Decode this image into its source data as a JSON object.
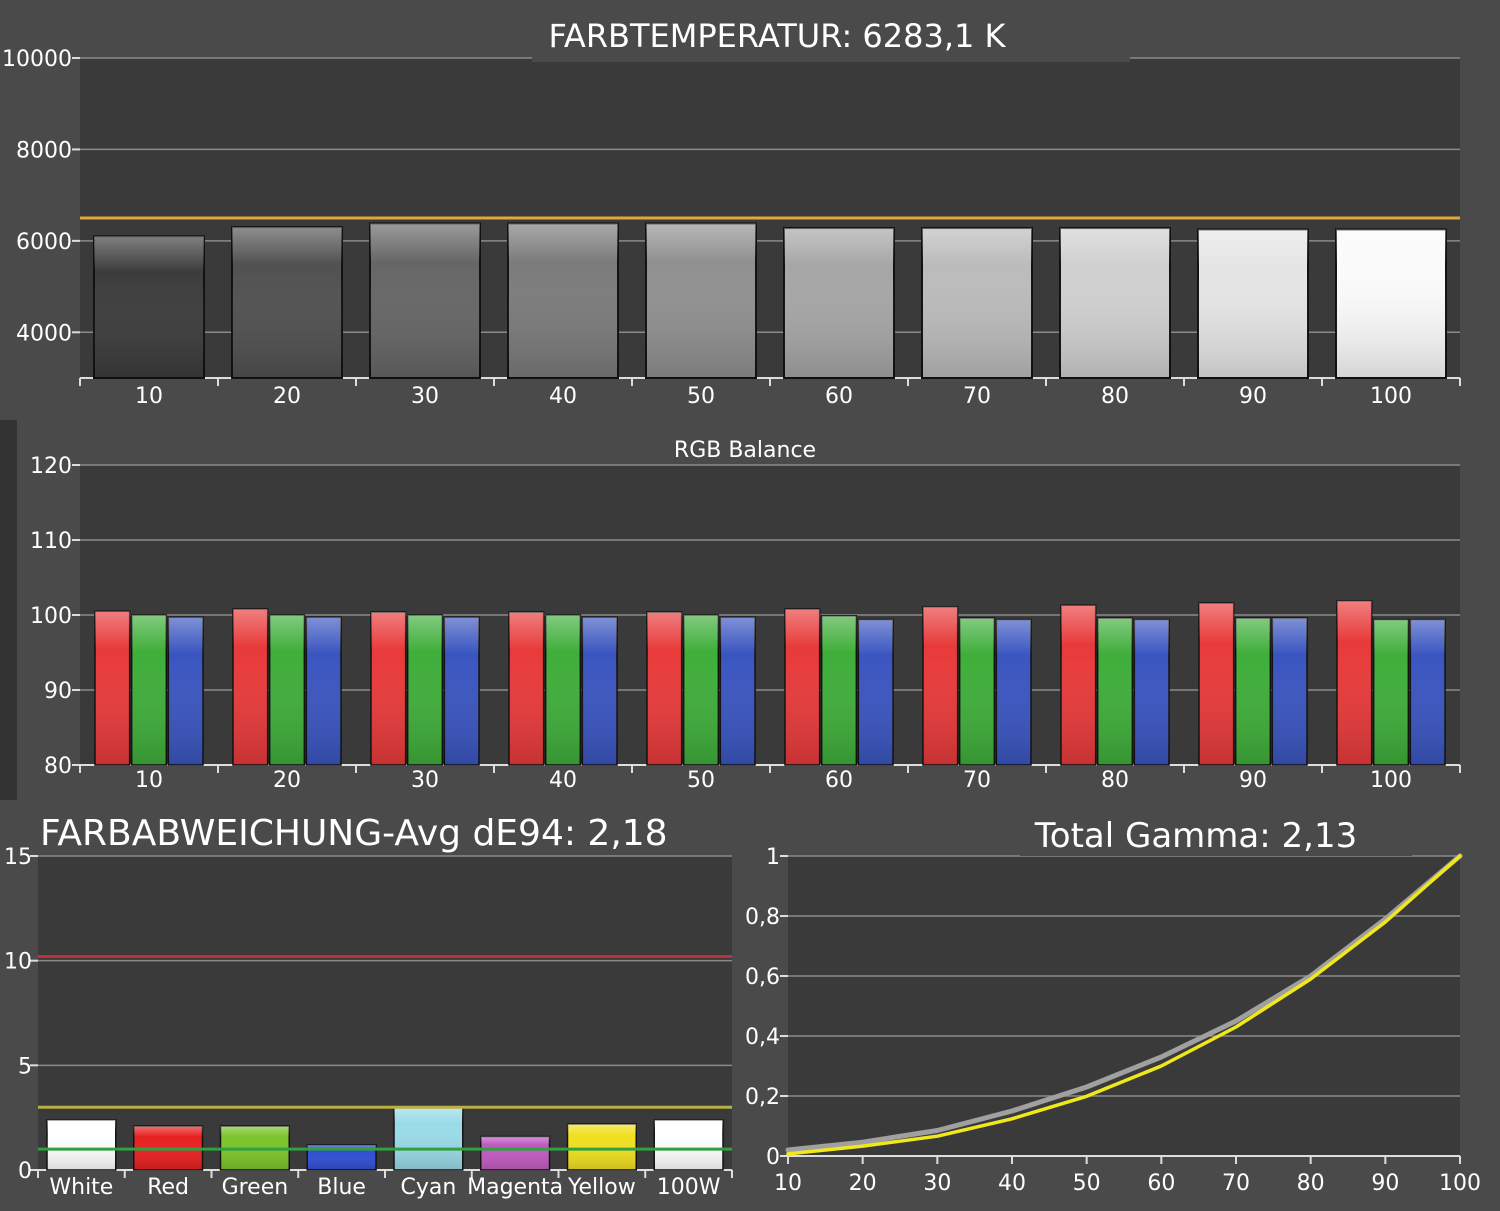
{
  "chart_data": [
    {
      "type": "bar",
      "title": "FARBTEMPERATUR: 6283,1 K",
      "categories": [
        "10",
        "20",
        "30",
        "40",
        "50",
        "60",
        "70",
        "80",
        "90",
        "100"
      ],
      "values": [
        6100,
        6300,
        6380,
        6380,
        6380,
        6280,
        6280,
        6280,
        6250,
        6250
      ],
      "ylim": [
        3000,
        10000
      ],
      "yticks": [
        "4000",
        "6000",
        "8000",
        "10000"
      ],
      "reference_line": 6500,
      "grid": true,
      "colors": {
        "reference": "#e0a83a"
      }
    },
    {
      "type": "bar",
      "title": "RGB Balance",
      "categories": [
        "10",
        "20",
        "30",
        "40",
        "50",
        "60",
        "70",
        "80",
        "90",
        "100"
      ],
      "series": [
        {
          "color": "#e83a3a",
          "values": [
            100.5,
            100.8,
            100.4,
            100.4,
            100.4,
            100.8,
            101.1,
            101.3,
            101.6,
            101.9
          ]
        },
        {
          "color": "#3fae3a",
          "values": [
            100.0,
            100.0,
            100.0,
            100.0,
            100.0,
            99.9,
            99.6,
            99.6,
            99.6,
            99.4
          ]
        },
        {
          "color": "#3a55c0",
          "values": [
            99.7,
            99.7,
            99.7,
            99.7,
            99.7,
            99.4,
            99.4,
            99.4,
            99.6,
            99.4
          ]
        }
      ],
      "ylim": [
        80,
        120
      ],
      "yticks": [
        "80",
        "90",
        "100",
        "110",
        "120"
      ],
      "grid": true
    },
    {
      "type": "bar",
      "title": "FARBABWEICHUNG-Avg dE94: 2,18",
      "categories": [
        "White",
        "Red",
        "Green",
        "Blue",
        "Cyan",
        "Magenta",
        "Yellow",
        "100W"
      ],
      "values": [
        2.4,
        2.1,
        2.1,
        1.2,
        3.0,
        1.6,
        2.2,
        2.4
      ],
      "bar_colors": [
        "#ffffff",
        "#e82020",
        "#7cc42a",
        "#2f4fd0",
        "#9adbe8",
        "#c05ac0",
        "#f0e020",
        "#ffffff"
      ],
      "ylim": [
        0,
        15
      ],
      "yticks": [
        "0",
        "5",
        "10",
        "15"
      ],
      "reference_lines": [
        {
          "value": 10.2,
          "color": "#c0303a"
        },
        {
          "value": 3.0,
          "color": "#b8b040"
        },
        {
          "value": 1.0,
          "color": "#30a040"
        }
      ],
      "grid": true
    },
    {
      "type": "line",
      "title": "Total Gamma: 2,13",
      "x": [
        10,
        20,
        30,
        40,
        50,
        60,
        70,
        80,
        90,
        100
      ],
      "series": [
        {
          "color": "#a0a0a0",
          "values": [
            0.02,
            0.046,
            0.085,
            0.15,
            0.23,
            0.33,
            0.45,
            0.6,
            0.79,
            1.0
          ]
        },
        {
          "color": "#f0e81a",
          "values": [
            0.007,
            0.033,
            0.066,
            0.124,
            0.199,
            0.3,
            0.43,
            0.59,
            0.78,
            1.0
          ]
        }
      ],
      "xlim": [
        10,
        100
      ],
      "ylim": [
        0,
        1
      ],
      "xticks": [
        "10",
        "20",
        "30",
        "40",
        "50",
        "60",
        "70",
        "80",
        "90",
        "100"
      ],
      "yticks": [
        "0",
        "0,2",
        "0,4",
        "0,6",
        "0,8",
        "1"
      ],
      "grid": true
    }
  ]
}
